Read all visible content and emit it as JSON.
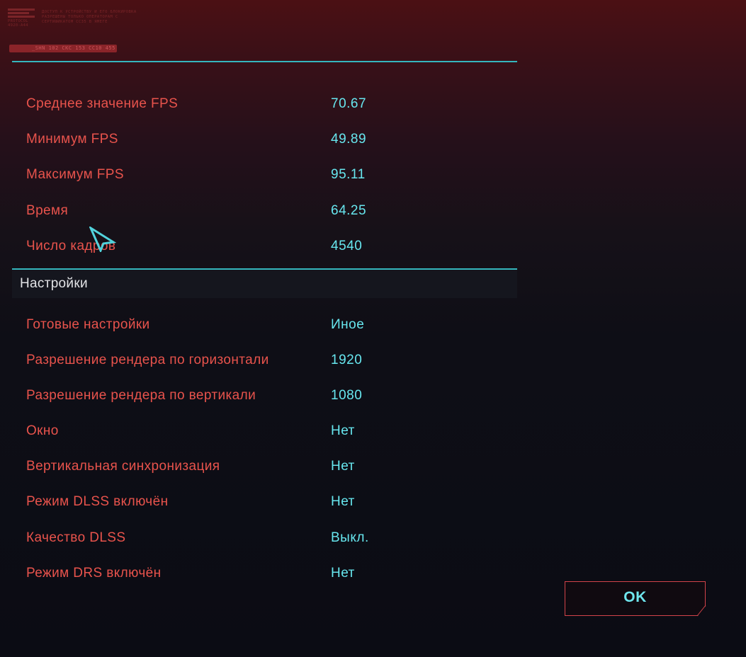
{
  "header": {
    "logo_code": "PROTOCOL 4920-A44",
    "notice": "ДОСТУП К УСТРОЙСТВУ И ЕГО БЛОКИРОВКА РАЗРЕШЕНЫ ТОЛЬКО ОПЕРАТОРАМ С СЕРТИФИКАТОМ СС35 В ЯМЕГЕ",
    "tag": "_SHN 102 CKC 153 CC10 455"
  },
  "stats": [
    {
      "label": "Среднее значение FPS",
      "value": "70.67"
    },
    {
      "label": "Минимум FPS",
      "value": "49.89"
    },
    {
      "label": "Максимум FPS",
      "value": "95.11"
    },
    {
      "label": "Время",
      "value": "64.25"
    },
    {
      "label": "Число кадров",
      "value": "4540"
    }
  ],
  "settings": {
    "title": "Настройки",
    "rows": [
      {
        "label": "Готовые настройки",
        "value": "Иное"
      },
      {
        "label": "Разрешение рендера по горизонтали",
        "value": "1920"
      },
      {
        "label": "Разрешение рендера по вертикали",
        "value": "1080"
      },
      {
        "label": "Окно",
        "value": "Нет"
      },
      {
        "label": "Вертикальная синхронизация",
        "value": "Нет"
      },
      {
        "label": "Режим DLSS включён",
        "value": "Нет"
      },
      {
        "label": "Качество DLSS",
        "value": "Выкл."
      },
      {
        "label": "Режим DRS включён",
        "value": "Нет"
      }
    ]
  },
  "ok_button": {
    "label": "OK"
  },
  "colors": {
    "accent_red": "#e8534c",
    "accent_cyan": "#67e6ee",
    "rule_cyan": "#35b6bd",
    "button_border": "#d2434a"
  },
  "cursor": {
    "icon": "pointer-cursor-icon"
  }
}
